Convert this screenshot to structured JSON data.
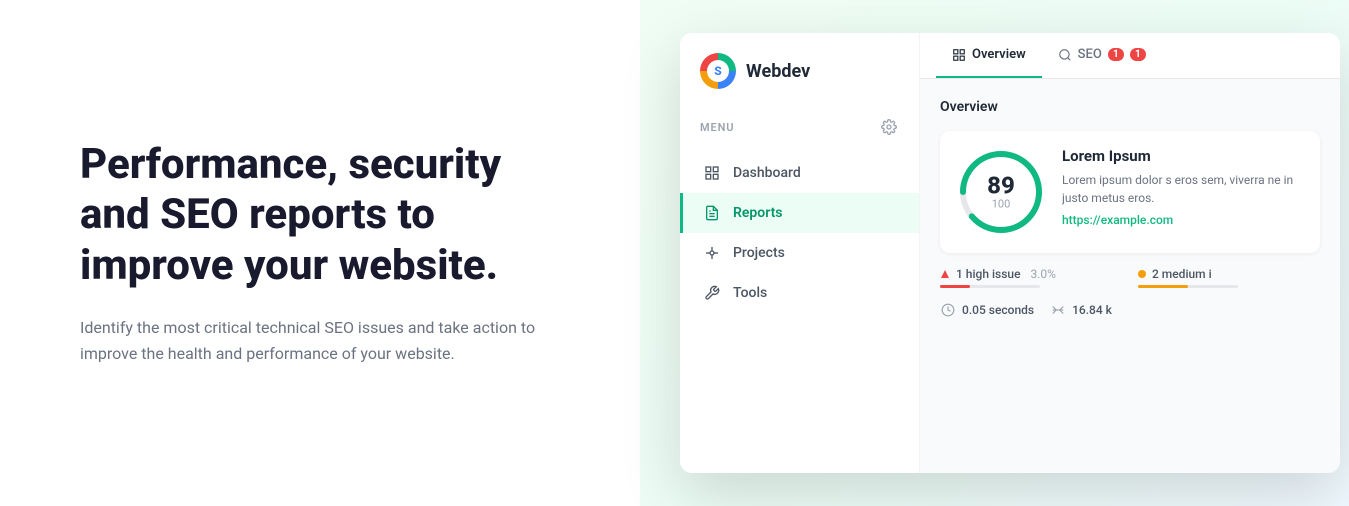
{
  "hero": {
    "title": "Performance, security and SEO reports to improve your website.",
    "subtitle": "Identify the most critical technical SEO issues and take action to improve the health and performance of your website."
  },
  "app": {
    "brand": {
      "name": "Webdev",
      "logo_letter": "S"
    },
    "menu_label": "MENU",
    "nav_items": [
      {
        "id": "dashboard",
        "label": "Dashboard",
        "active": false
      },
      {
        "id": "reports",
        "label": "Reports",
        "active": true
      },
      {
        "id": "projects",
        "label": "Projects",
        "active": false
      },
      {
        "id": "tools",
        "label": "Tools",
        "active": false
      }
    ],
    "tabs": [
      {
        "id": "overview",
        "label": "Overview",
        "active": true,
        "badge": null
      },
      {
        "id": "seo",
        "label": "SEO",
        "active": false,
        "badge": "1"
      }
    ],
    "overview": {
      "section_title": "Overview",
      "score": {
        "value": "89",
        "max": "100",
        "title": "Lorem Ipsum",
        "description": "Lorem ipsum dolor s eros sem, viverra ne in justo metus eros.",
        "link": "https://example.com"
      },
      "issues": [
        {
          "type": "high",
          "label": "1 high issue",
          "percent": "3.0%",
          "color": "red"
        },
        {
          "type": "medium",
          "label": "2 medium i",
          "color": "yellow"
        }
      ],
      "stats": [
        {
          "icon": "timer",
          "value": "0.05 seconds"
        },
        {
          "icon": "scale",
          "value": "16.84 k"
        }
      ]
    }
  }
}
